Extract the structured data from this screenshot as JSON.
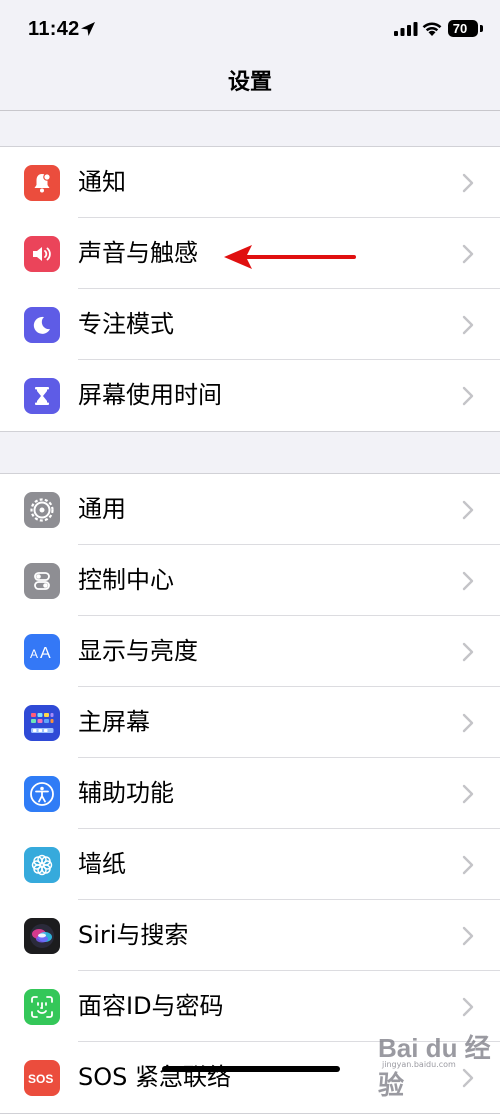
{
  "status_bar": {
    "time": "11:42",
    "battery": "70"
  },
  "nav": {
    "title": "设置"
  },
  "groups": [
    {
      "items": [
        {
          "label": "通知",
          "icon": "notifications-icon",
          "color": "#eb4d3d"
        },
        {
          "label": "声音与触感",
          "icon": "sounds-icon",
          "color": "#eb445a"
        },
        {
          "label": "专注模式",
          "icon": "focus-moon-icon",
          "color": "#5e5ce6"
        },
        {
          "label": "屏幕使用时间",
          "icon": "screen-time-hourglass-icon",
          "color": "#5e5ce6"
        }
      ]
    },
    {
      "items": [
        {
          "label": "通用",
          "icon": "general-gear-icon",
          "color": "#8e8e93"
        },
        {
          "label": "控制中心",
          "icon": "control-center-icon",
          "color": "#8e8e93"
        },
        {
          "label": "显示与亮度",
          "icon": "display-brightness-icon",
          "color": "#3478f6"
        },
        {
          "label": "主屏幕",
          "icon": "home-screen-icon",
          "color": "#2f4ad6"
        },
        {
          "label": "辅助功能",
          "icon": "accessibility-icon",
          "color": "#2f7cf6"
        },
        {
          "label": "墙纸",
          "icon": "wallpaper-flower-icon",
          "color": "#36aadc"
        },
        {
          "label": "Siri与搜索",
          "icon": "siri-icon",
          "color": "#1c1c1e"
        },
        {
          "label": "面容ID与密码",
          "icon": "face-id-icon",
          "color": "#34c759"
        },
        {
          "label": "SOS 紧急联络",
          "icon": "sos-icon",
          "color": "#eb4d3d"
        }
      ]
    }
  ],
  "watermark": {
    "main": "Bai du 经验",
    "sub": "jingyan.baidu.com"
  }
}
